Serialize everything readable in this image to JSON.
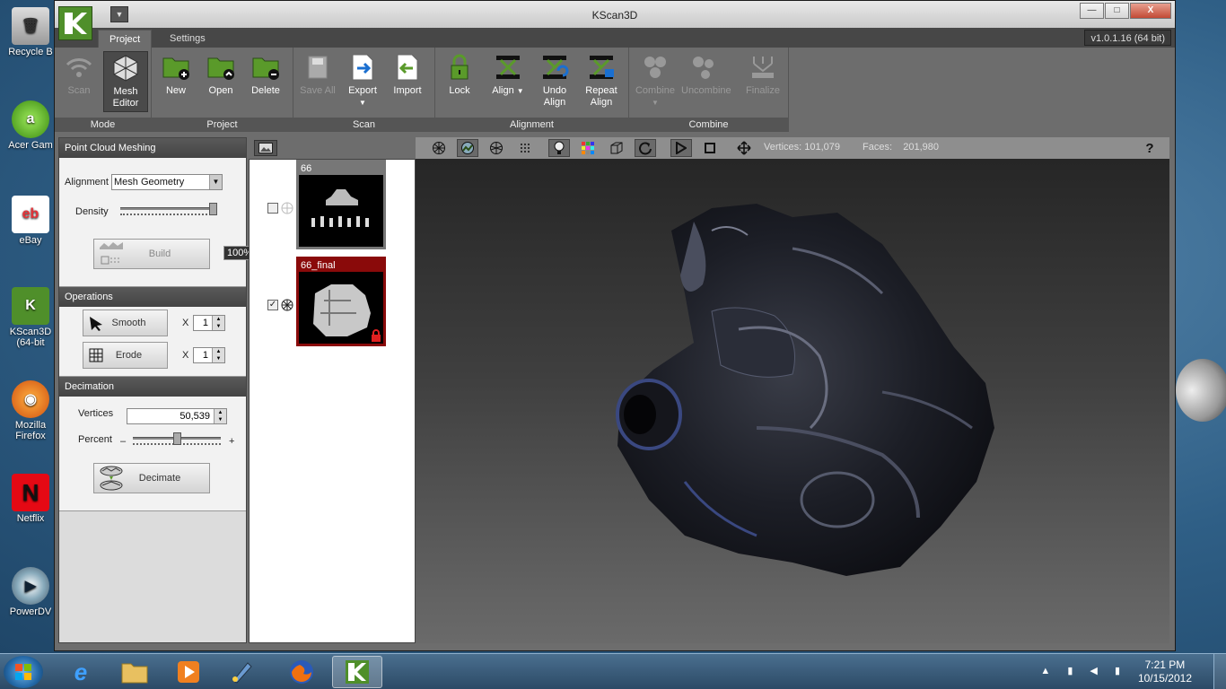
{
  "desktop": {
    "icons": [
      {
        "label": "Recycle B",
        "icon": "recycle-bin-icon"
      },
      {
        "label": "Acer Gam",
        "icon": "acer-games-icon"
      },
      {
        "label": "eBay",
        "icon": "ebay-icon"
      },
      {
        "label": "KScan3D (64-bit",
        "icon": "kscan3d-icon"
      },
      {
        "label": "Mozilla Firefox",
        "icon": "firefox-icon"
      },
      {
        "label": "Netflix",
        "icon": "netflix-icon"
      },
      {
        "label": "PowerDV",
        "icon": "powerdvd-icon"
      }
    ]
  },
  "window": {
    "title": "KScan3D",
    "version": "v1.0.1.16  (64 bit)",
    "controls": {
      "minimize": "—",
      "maximize": "□",
      "close": "X"
    },
    "quick_access": "▼"
  },
  "tabs": [
    {
      "label": "Project",
      "active": true
    },
    {
      "label": "Settings",
      "active": false
    }
  ],
  "ribbon": {
    "groups": [
      {
        "label": "Mode",
        "buttons": [
          {
            "label": "Scan",
            "disabled": true,
            "icon": "wifi-scan-icon"
          },
          {
            "label": "Mesh Editor",
            "active": true,
            "icon": "mesh-icon"
          }
        ]
      },
      {
        "label": "Project",
        "buttons": [
          {
            "label": "New",
            "icon": "folder-new-icon"
          },
          {
            "label": "Open",
            "icon": "folder-open-icon"
          },
          {
            "label": "Delete",
            "icon": "folder-delete-icon"
          }
        ]
      },
      {
        "label": "Scan",
        "buttons": [
          {
            "label": "Save All",
            "disabled": true,
            "icon": "save-icon"
          },
          {
            "label": "Export",
            "icon": "export-icon"
          },
          {
            "label": "Import",
            "icon": "import-icon"
          }
        ]
      },
      {
        "label": "Alignment",
        "buttons": [
          {
            "label": "Lock",
            "icon": "lock-icon"
          },
          {
            "label": "Align",
            "icon": "align-icon"
          },
          {
            "label": "Undo Align",
            "icon": "undo-align-icon"
          },
          {
            "label": "Repeat Align",
            "icon": "repeat-align-icon"
          }
        ]
      },
      {
        "label": "Combine",
        "buttons": [
          {
            "label": "Combine",
            "disabled": true,
            "icon": "combine-icon"
          },
          {
            "label": "Uncombine",
            "disabled": true,
            "icon": "uncombine-icon"
          },
          {
            "label": "Finalize",
            "disabled": true,
            "icon": "finalize-icon"
          }
        ]
      }
    ]
  },
  "left_panel": {
    "meshing": {
      "title": "Point Cloud Meshing",
      "alignment_label": "Alignment",
      "alignment_value": "Mesh Geometry",
      "density_label": "Density",
      "density_fraction": 1.0,
      "density_tooltip": "100%",
      "build_label": "Build"
    },
    "operations": {
      "title": "Operations",
      "smooth_label": "Smooth",
      "smooth_x": "X",
      "smooth_value": "1",
      "erode_label": "Erode",
      "erode_x": "X",
      "erode_value": "1"
    },
    "decimation": {
      "title": "Decimation",
      "vertices_label": "Vertices",
      "vertices_value": "50,539",
      "percent_label": "Percent",
      "percent_minus": "–",
      "percent_plus": "+",
      "percent_fraction": 0.5,
      "decimate_label": "Decimate"
    }
  },
  "scans": [
    {
      "name": "66",
      "checked": false,
      "locked": false,
      "selected": false
    },
    {
      "name": "66_final",
      "checked": true,
      "locked": true,
      "selected": true
    }
  ],
  "viewport": {
    "vertices_label": "Vertices:",
    "vertices_value": "101,079",
    "faces_label": "Faces:",
    "faces_value": "201,980",
    "help": "?"
  },
  "taskbar": {
    "time": "7:21 PM",
    "date": "10/15/2012"
  }
}
